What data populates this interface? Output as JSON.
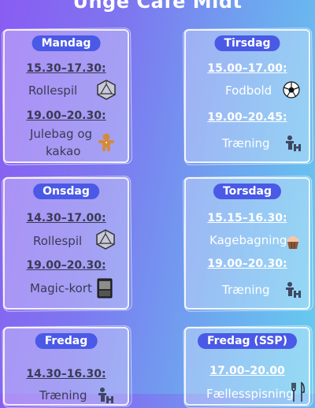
{
  "title": "Unge Café Midt",
  "cards": [
    {
      "day": "Mandag",
      "time1": "15.30–17.30:",
      "act1": "Rollespil",
      "icon1": "d20-icon",
      "time2": "19.00–20.30:",
      "act2a": "Julebag og",
      "act2b": "kakao",
      "icon2": "gingerbread-icon"
    },
    {
      "day": "Tirsdag",
      "time1": "15.00–17.00:",
      "act1": "Fodbold",
      "icon1": "football-icon",
      "time2": "19.00–20.45:",
      "act2": "Træning",
      "icon2": "weightlifting-icon"
    },
    {
      "day": "Onsdag",
      "time1": "14.30–17.00:",
      "act1": "Rollespil",
      "icon1": "d20-icon",
      "time2": "19.00–20.30:",
      "act2": "Magic-kort",
      "icon2": "magic-card-icon"
    },
    {
      "day": "Torsdag",
      "time1": "15.15–16.30:",
      "act1": "Kagebagning",
      "icon1": "cupcake-icon",
      "time2": "19.00–20.30:",
      "act2": "Træning",
      "icon2": "weightlifting-icon"
    },
    {
      "day": "Fredag",
      "time1": "14.30–16.30:",
      "act1": "Træning",
      "icon1": "weightlifting-icon"
    },
    {
      "day": "Fredag (SSP)",
      "time1": "17.00–20.00",
      "act1": "Fællesspisning",
      "icon1": "cutlery-icon"
    }
  ]
}
